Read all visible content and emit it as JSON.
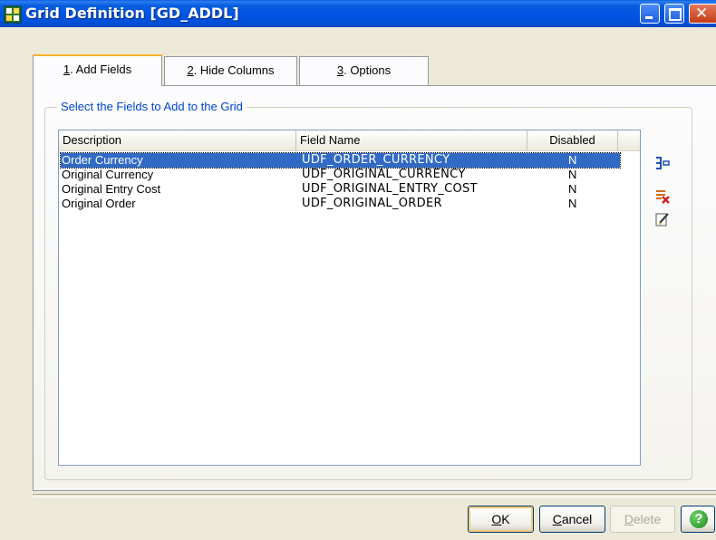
{
  "window": {
    "title": "Grid Definition  [GD_ADDL]"
  },
  "tabs": [
    {
      "mnemonic": "1",
      "rest": ". Add Fields",
      "active": true
    },
    {
      "mnemonic": "2",
      "rest": ". Hide Columns",
      "active": false
    },
    {
      "mnemonic": "3",
      "rest": ". Options",
      "active": false
    }
  ],
  "group": {
    "label": "Select the Fields to Add to the Grid"
  },
  "list": {
    "columns": [
      "Description",
      "Field Name",
      "Disabled"
    ],
    "rows": [
      {
        "description": "Order Currency",
        "field_name": "UDF_ORDER_CURRENCY",
        "disabled": "N",
        "selected": true
      },
      {
        "description": "Original Currency",
        "field_name": "UDF_ORIGINAL_CURRENCY",
        "disabled": "N",
        "selected": false
      },
      {
        "description": "Original Entry Cost",
        "field_name": "UDF_ORIGINAL_ENTRY_COST",
        "disabled": "N",
        "selected": false
      },
      {
        "description": "Original Order",
        "field_name": "UDF_ORIGINAL_ORDER",
        "disabled": "N",
        "selected": false
      }
    ]
  },
  "side_icons": [
    "add-column-icon",
    "delete-column-icon",
    "edit-column-icon"
  ],
  "buttons": {
    "ok": {
      "mnemonic": "O",
      "rest": "K"
    },
    "cancel": {
      "mnemonic": "C",
      "rest": "ancel"
    },
    "delete": {
      "mnemonic": "D",
      "rest": "elete",
      "enabled": false
    },
    "help": {
      "glyph": "?"
    }
  },
  "colors": {
    "titlebar": "#0054e3",
    "selection": "#316ac5",
    "group_label": "#0046d5",
    "tab_highlight": "#f8b130",
    "help": "#1f8a1c"
  }
}
